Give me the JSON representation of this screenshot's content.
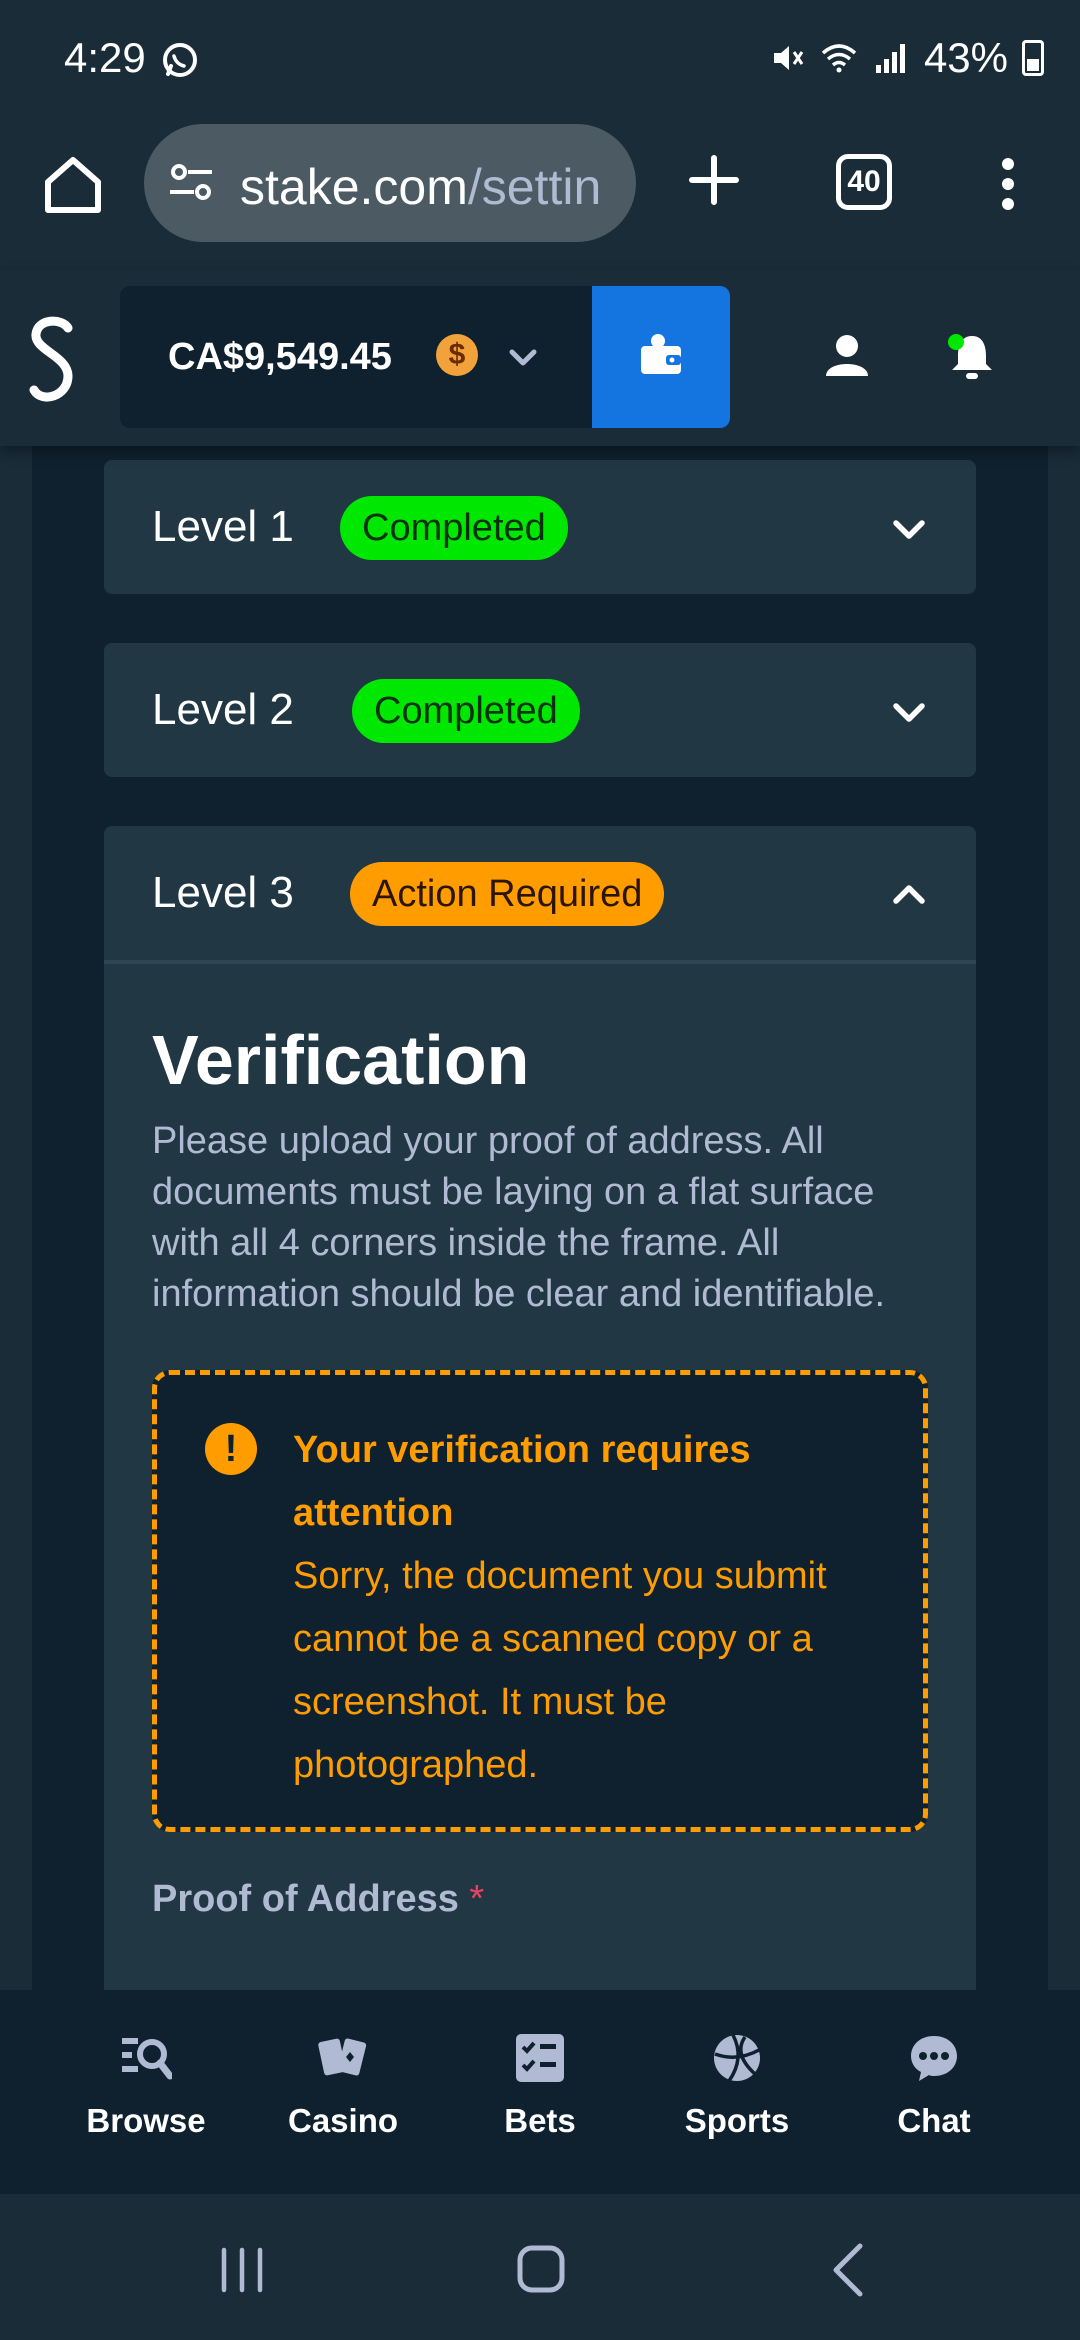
{
  "status_bar": {
    "time": "4:29",
    "battery": "43%",
    "icons": [
      "whatsapp-icon",
      "mute-icon",
      "wifi-icon",
      "signal-icon",
      "battery-icon"
    ]
  },
  "browser": {
    "url_host": "stake.com",
    "url_path": "/settin",
    "tab_count": "40"
  },
  "header": {
    "balance": "CA$9,549.45",
    "currency_symbol": "$"
  },
  "levels": [
    {
      "label": "Level 1",
      "status": "Completed",
      "expanded": false
    },
    {
      "label": "Level 2",
      "status": "Completed",
      "expanded": false
    },
    {
      "label": "Level 3",
      "status": "Action Required",
      "expanded": true
    }
  ],
  "verification": {
    "title": "Verification",
    "description": "Please upload your proof of address. All documents must be laying on a flat surface with all 4 corners inside the frame. All information should be clear and identifiable.",
    "alert_icon": "!",
    "alert_title": "Your verification requires attention",
    "alert_message": "Sorry, the document you submit cannot be a scanned copy or a screenshot. It must be photographed.",
    "field_label": "Proof of Address",
    "required_marker": "*"
  },
  "bottom_nav": [
    {
      "label": "Browse",
      "icon": "browse-icon"
    },
    {
      "label": "Casino",
      "icon": "casino-icon"
    },
    {
      "label": "Bets",
      "icon": "bets-icon"
    },
    {
      "label": "Sports",
      "icon": "sports-icon"
    },
    {
      "label": "Chat",
      "icon": "chat-icon"
    }
  ],
  "colors": {
    "background": "#0f212e",
    "card": "#213743",
    "header": "#1a2c38",
    "accent_blue": "#1475e1",
    "success_green": "#00e701",
    "warning_orange": "#ff9d00"
  }
}
